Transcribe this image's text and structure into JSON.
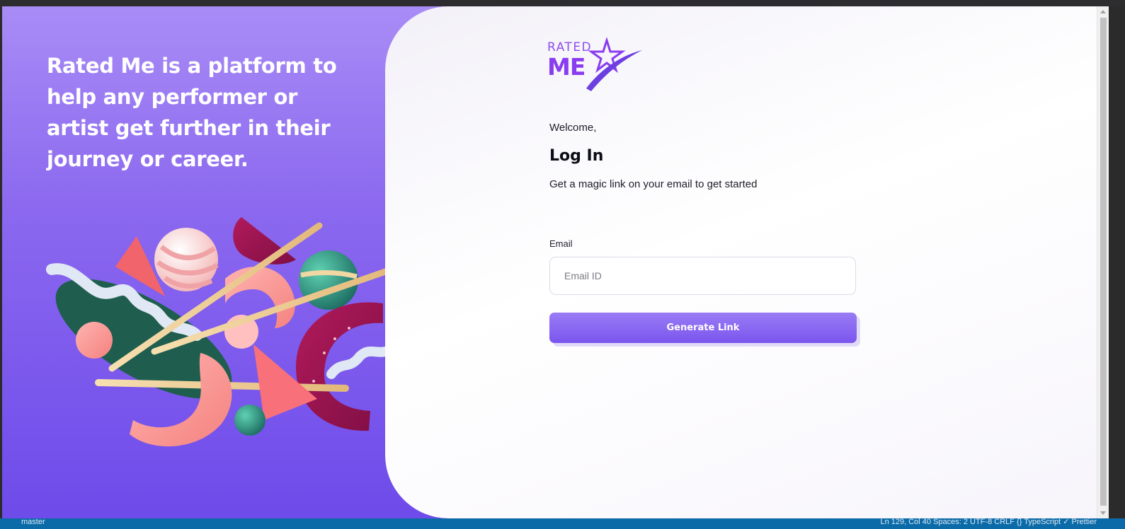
{
  "hero": {
    "tagline": "Rated Me is a platform to help any performer or artist get further in their journey or career."
  },
  "logo": {
    "line1": "RATED",
    "line2": "ME"
  },
  "login": {
    "welcome": "Welcome,",
    "heading": "Log In",
    "subtitle": "Get a magic link on your email to get started",
    "email_label": "Email",
    "email_placeholder": "Email ID",
    "email_value": "",
    "button_label": "Generate Link"
  },
  "status_bar": {
    "branch": "master",
    "right_text": "Ln 129, Col 40   Spaces: 2   UTF-8   CRLF   {} TypeScript   ✓ Prettier"
  },
  "colors": {
    "gradient_top": "#a98cf6",
    "gradient_bottom": "#6e4bea",
    "brand_purple": "#8a3cf0",
    "button_top": "#9a7cf5",
    "button_bottom": "#7a55ee"
  }
}
